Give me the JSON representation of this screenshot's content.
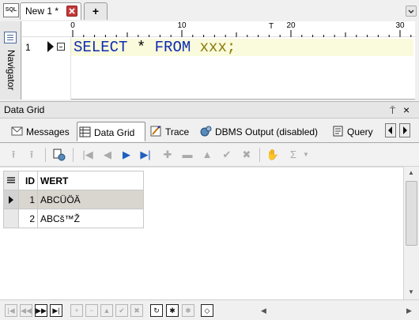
{
  "tabstrip": {
    "app_icon_label": "SQL",
    "doc_tab_label": "New 1 *",
    "new_tab_label": "+",
    "dropdown_icon": "chevron-down-icon"
  },
  "navigator": {
    "label": "Navigator"
  },
  "ruler": {
    "labels": [
      "0",
      "10",
      "20",
      "30"
    ]
  },
  "editor": {
    "line_number": "1",
    "code": {
      "select": "SELECT",
      "star": "*",
      "from": "FROM",
      "table": "xxx",
      "semicolon": ";"
    },
    "colors": {
      "keyword": "#0f2cb0",
      "identifier": "#8a7a0c",
      "current_line": "#fafadc"
    }
  },
  "data_grid_panel": {
    "title": "Data Grid",
    "pin_label": "⍑",
    "close_label": "×",
    "tabs": [
      "Messages",
      "Data Grid",
      "Trace",
      "DBMS Output (disabled)",
      "Query"
    ],
    "active_tab": "Data Grid"
  },
  "grid": {
    "columns": [
      "ID",
      "WERT"
    ],
    "rows": [
      {
        "id": "1",
        "wert": "ABCÜÖÄ",
        "selected": true
      },
      {
        "id": "2",
        "wert": "ABCš™Ž",
        "selected": false
      }
    ],
    "selection_color": "#d9d6cf"
  }
}
